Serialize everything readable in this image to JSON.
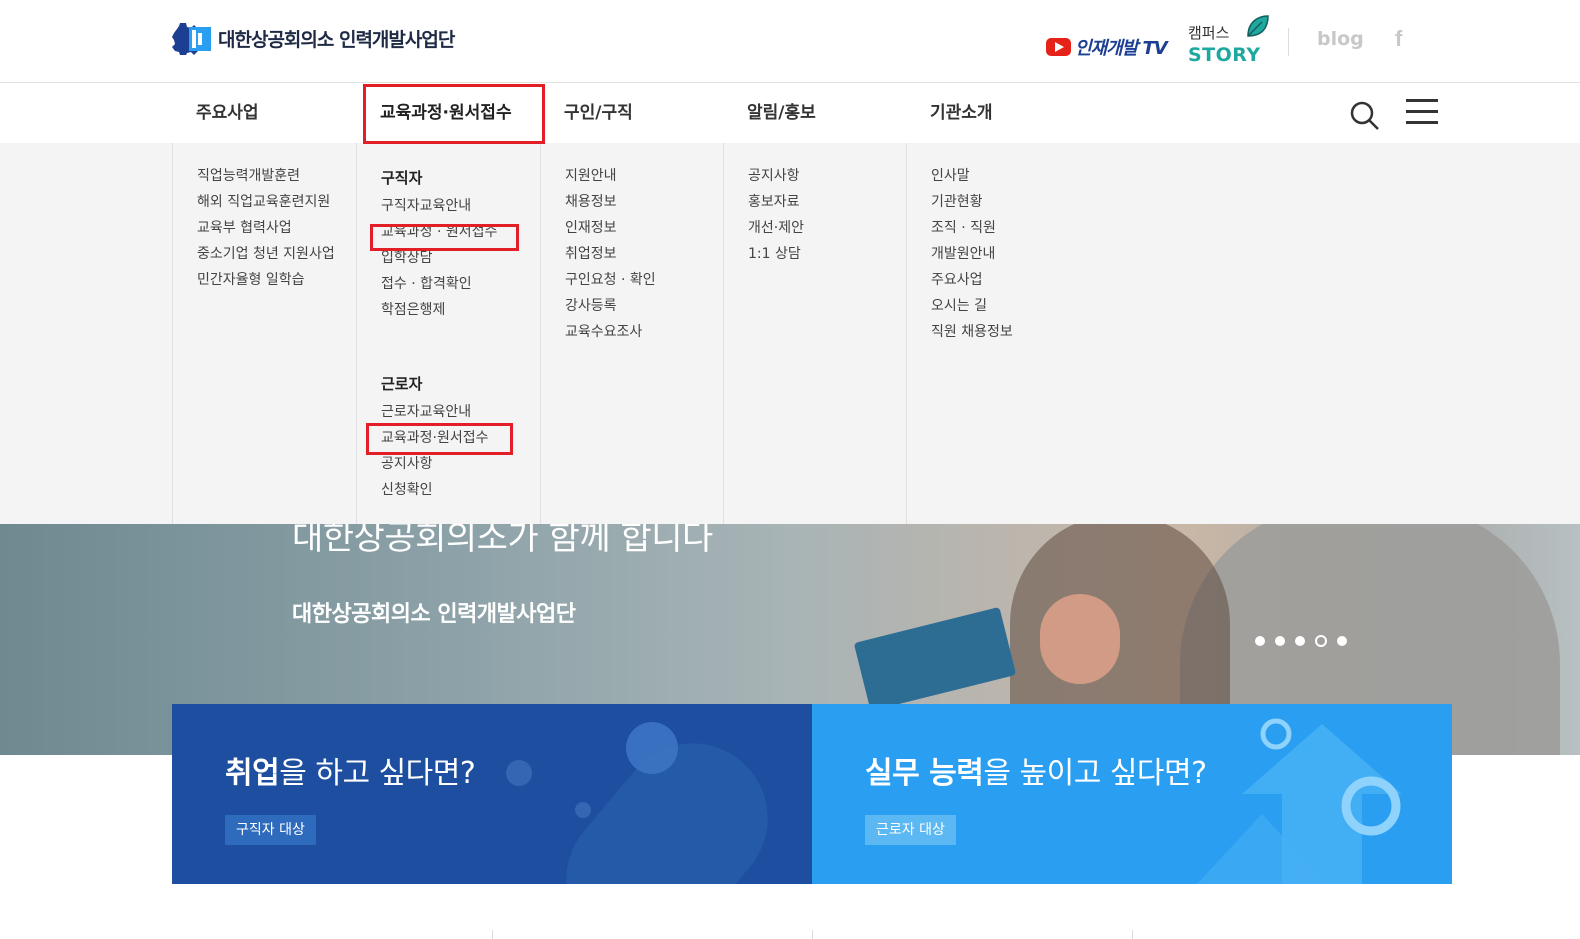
{
  "header": {
    "logo_text": "대한상공회의소 인력개발사업단",
    "tv_label": "인재개발 TV",
    "campus_top": "캠퍼스",
    "campus_story": "STORY",
    "blog_label": "blog",
    "facebook_label": "f"
  },
  "gnb": {
    "items": [
      {
        "label": "주요사업"
      },
      {
        "label": "교육과정·원서접수"
      },
      {
        "label": "구인/구직"
      },
      {
        "label": "알림/홍보"
      },
      {
        "label": "기관소개"
      }
    ]
  },
  "mega_menu": {
    "business": [
      "직업능력개발훈련",
      "해외 직업교육훈련지원",
      "교육부 협력사업",
      "중소기업 청년 지원사업",
      "민간자율형 일학습"
    ],
    "education": {
      "jobseeker_title": "구직자",
      "jobseeker_items": [
        "구직자교육안내",
        "교육과정 · 원서접수",
        "입학상담",
        "접수 · 합격확인",
        "학점은행제"
      ],
      "worker_title": "근로자",
      "worker_items": [
        "근로자교육안내",
        "교육과정·원서접수",
        "공지사항",
        "신청확인"
      ]
    },
    "recruit": [
      "지원안내",
      "채용정보",
      "인재정보",
      "취업정보",
      "구인요청 · 확인",
      "강사등록",
      "교육수요조사"
    ],
    "notice": [
      "공지사항",
      "홍보자료",
      "개선·제안",
      "1:1 상담"
    ],
    "about": [
      "인사말",
      "기관현황",
      "조직 · 직원",
      "개발원안내",
      "주요사업",
      "오시는 길",
      "직원 채용정보"
    ]
  },
  "hero": {
    "title": "대한상공회의소가 함께 합니다",
    "subtitle": "대한상공회의소 인력개발사업단"
  },
  "banners": {
    "left": {
      "title_bold": "취업",
      "title_rest": "을 하고 싶다면?",
      "button": "구직자 대상"
    },
    "right": {
      "title_bold": "실무 능력",
      "title_rest": "을 높이고 싶다면?",
      "button": "근로자 대상"
    }
  },
  "colors": {
    "highlight": "#e21f26",
    "banner_left": "#1d4e9f",
    "banner_right": "#2a9ef0",
    "story": "#1fa89f"
  }
}
